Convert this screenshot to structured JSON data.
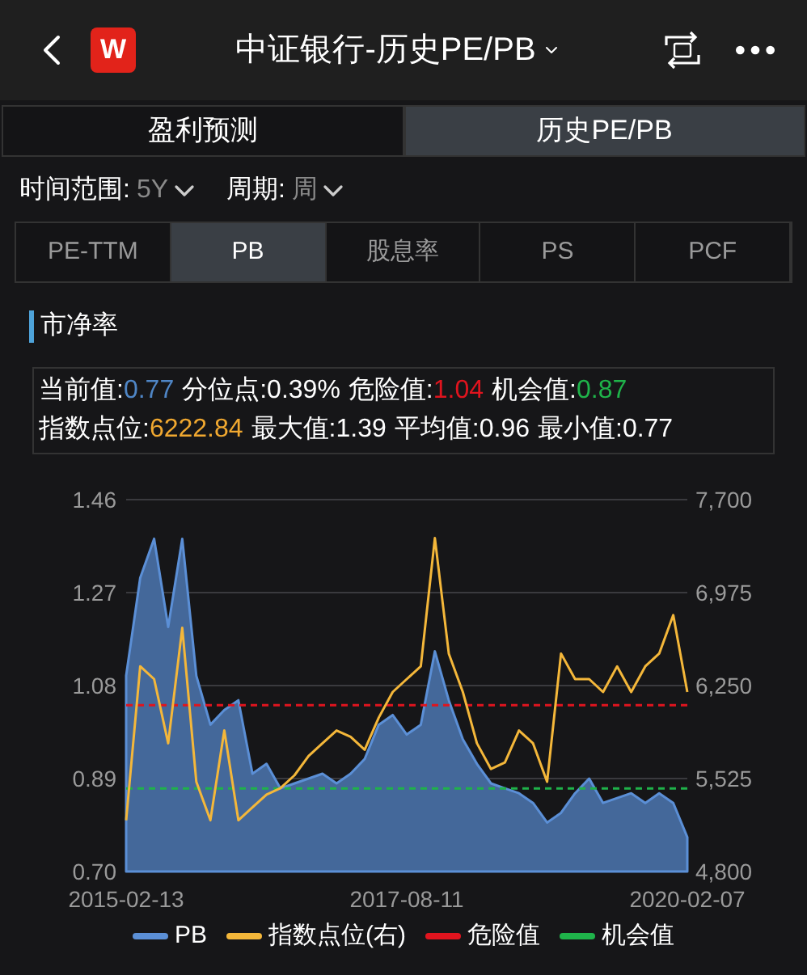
{
  "header": {
    "logo": "W",
    "title": "中证银行-历史PE/PB"
  },
  "segments": [
    {
      "label": "盈利预测",
      "selected": false
    },
    {
      "label": "历史PE/PB",
      "selected": true
    }
  ],
  "filters": [
    {
      "label": "时间范围:",
      "value": "5Y"
    },
    {
      "label": "周期:",
      "value": "周"
    }
  ],
  "metric_tabs": [
    {
      "label": "PE-TTM",
      "selected": false
    },
    {
      "label": "PB",
      "selected": true
    },
    {
      "label": "股息率",
      "selected": false
    },
    {
      "label": "PS",
      "selected": false
    },
    {
      "label": "PCF",
      "selected": false
    }
  ],
  "section_title": "市净率",
  "stats": [
    [
      {
        "label": "当前值:",
        "value": "0.77",
        "color": "#4f86c6"
      },
      {
        "label": "分位点:",
        "value": "0.39%"
      },
      {
        "label": "危险值:",
        "value": "1.04",
        "color": "#e0141e"
      },
      {
        "label": "机会值:",
        "value": "0.87",
        "color": "#1fb34a"
      }
    ],
    [
      {
        "label": "指数点位:",
        "value": "6222.84",
        "color": "#f0a830"
      },
      {
        "label": "最大值:",
        "value": "1.39"
      },
      {
        "label": "平均值:",
        "value": "0.96"
      },
      {
        "label": "最小值:",
        "value": "0.77"
      }
    ]
  ],
  "pb_chart": {
    "chart_data": {
      "type": "area",
      "grid": true,
      "ylim": [
        0.7,
        1.46
      ],
      "yticks": [
        {
          "value": 0.7,
          "label": "0.70"
        },
        {
          "value": 0.89,
          "label": "0.89"
        },
        {
          "value": 1.08,
          "label": "1.08"
        },
        {
          "value": 1.27,
          "label": "1.27"
        },
        {
          "value": 1.46,
          "label": "1.46"
        }
      ],
      "categories": [
        "2015-02-13",
        null,
        null,
        null,
        null,
        null,
        null,
        null,
        null,
        null,
        null,
        null,
        null,
        null,
        null,
        null,
        null,
        null,
        null,
        null,
        "2017-08-11",
        null,
        null,
        null,
        null,
        null,
        null,
        null,
        null,
        null,
        null,
        null,
        null,
        null,
        null,
        null,
        null,
        null,
        null,
        null,
        "2020-02-07"
      ],
      "series": [
        {
          "name": "PB",
          "color": "#5b8fd6",
          "values": [
            1.1,
            1.3,
            1.38,
            1.2,
            1.38,
            1.1,
            1.0,
            1.03,
            1.05,
            0.9,
            0.92,
            0.87,
            0.88,
            0.89,
            0.9,
            0.88,
            0.9,
            0.93,
            1.0,
            1.02,
            0.98,
            1.0,
            1.15,
            1.05,
            0.97,
            0.92,
            0.88,
            0.87,
            0.86,
            0.84,
            0.8,
            0.82,
            0.86,
            0.89,
            0.84,
            0.85,
            0.86,
            0.84,
            0.86,
            0.84,
            0.77
          ]
        },
        {
          "name": "危险值",
          "color": "#e0141e",
          "type": "line",
          "line_style": "dashed",
          "values": [
            1.04,
            1.04,
            1.04,
            1.04,
            1.04,
            1.04,
            1.04,
            1.04,
            1.04,
            1.04,
            1.04,
            1.04,
            1.04,
            1.04,
            1.04,
            1.04,
            1.04,
            1.04,
            1.04,
            1.04,
            1.04,
            1.04,
            1.04,
            1.04,
            1.04,
            1.04,
            1.04,
            1.04,
            1.04,
            1.04,
            1.04,
            1.04,
            1.04,
            1.04,
            1.04,
            1.04,
            1.04,
            1.04,
            1.04,
            1.04,
            1.04
          ]
        },
        {
          "name": "机会值",
          "color": "#1fb34a",
          "type": "line",
          "line_style": "dashed",
          "values": [
            0.87,
            0.87,
            0.87,
            0.87,
            0.87,
            0.87,
            0.87,
            0.87,
            0.87,
            0.87,
            0.87,
            0.87,
            0.87,
            0.87,
            0.87,
            0.87,
            0.87,
            0.87,
            0.87,
            0.87,
            0.87,
            0.87,
            0.87,
            0.87,
            0.87,
            0.87,
            0.87,
            0.87,
            0.87,
            0.87,
            0.87,
            0.87,
            0.87,
            0.87,
            0.87,
            0.87,
            0.87,
            0.87,
            0.87,
            0.87,
            0.87
          ]
        }
      ]
    }
  },
  "index_chart": {
    "chart_data": {
      "type": "line",
      "ylim": [
        4800,
        7700
      ],
      "yticks": [
        {
          "value": 4800,
          "label": "4,800"
        },
        {
          "value": 5525,
          "label": "5,525"
        },
        {
          "value": 6250,
          "label": "6,250"
        },
        {
          "value": 6975,
          "label": "6,975"
        },
        {
          "value": 7700,
          "label": "7,700"
        }
      ],
      "categories": [
        null,
        null,
        null,
        null,
        null,
        null,
        null,
        null,
        null,
        null,
        null,
        null,
        null,
        null,
        null,
        null,
        null,
        null,
        null,
        null,
        null,
        null,
        null,
        null,
        null,
        null,
        null,
        null,
        null,
        null,
        null,
        null,
        null,
        null,
        null,
        null,
        null,
        null,
        null,
        null,
        null
      ],
      "series": [
        {
          "name": "指数点位(右)",
          "color": "#f4b73a",
          "values": [
            5200,
            6400,
            6300,
            5800,
            6700,
            5500,
            5200,
            5900,
            5200,
            5300,
            5400,
            5450,
            5550,
            5700,
            5800,
            5900,
            5850,
            5750,
            6000,
            6200,
            6300,
            6400,
            7400,
            6500,
            6200,
            5800,
            5600,
            5650,
            5900,
            5800,
            5500,
            6500,
            6300,
            6300,
            6200,
            6400,
            6200,
            6400,
            6500,
            6800,
            6200
          ]
        }
      ]
    }
  }
}
